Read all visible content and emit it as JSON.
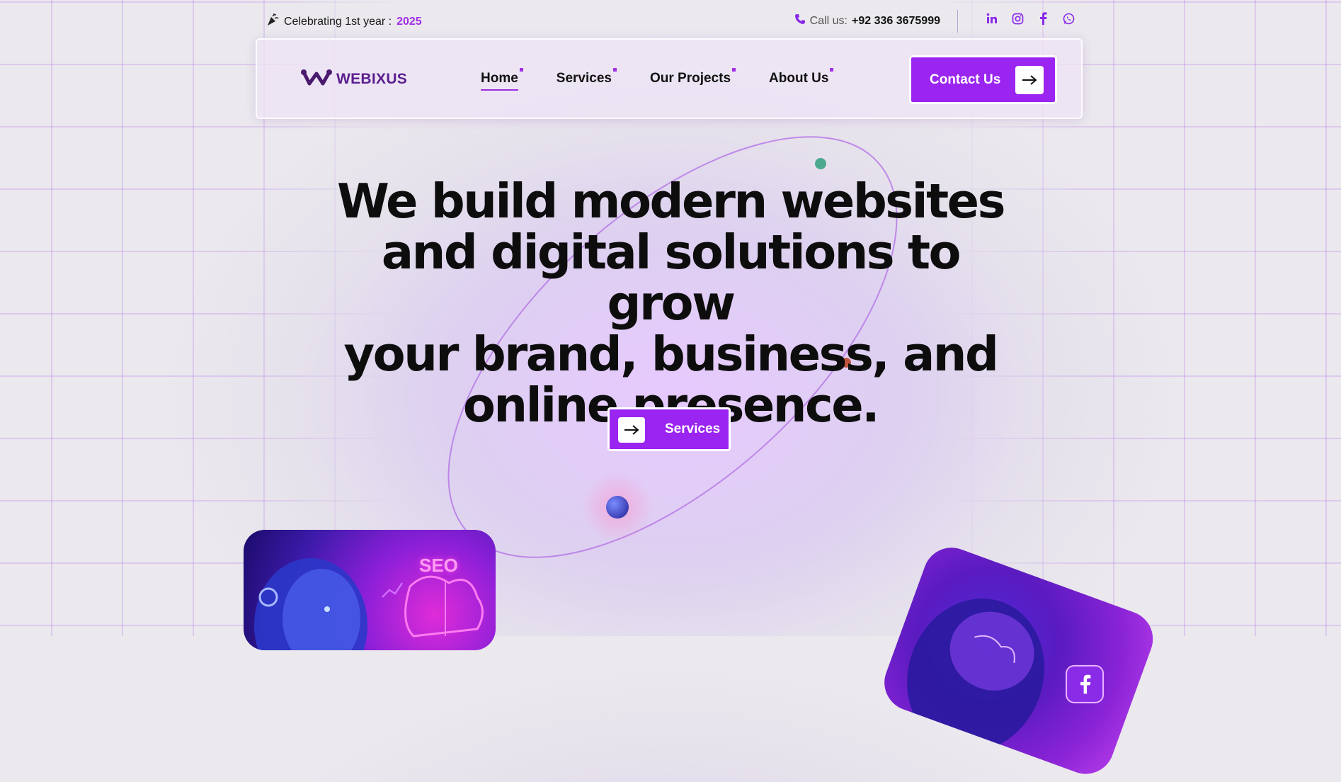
{
  "topbar": {
    "celebrating_text": "Celebrating 1st year :",
    "celebrating_year": "2025",
    "call_label": "Call us:",
    "phone": "+92 336 3675999",
    "socials": [
      "linkedin-icon",
      "instagram-icon",
      "facebook-icon",
      "whatsapp-icon"
    ]
  },
  "nav": {
    "logo_text": "WEBIXUS",
    "items": [
      {
        "label": "Home",
        "active": true
      },
      {
        "label": "Services",
        "active": false
      },
      {
        "label": "Our Projects",
        "active": false
      },
      {
        "label": "About Us",
        "active": false
      }
    ],
    "contact_label": "Contact Us"
  },
  "hero": {
    "title_lines": [
      "We build modern websites",
      "and digital solutions to grow",
      "your brand, business, and",
      "online presence."
    ],
    "cta_label": "Services"
  },
  "cards": {
    "left_badge": "SEO"
  },
  "colors": {
    "accent": "#9b25f0",
    "logo": "#5a1e8e",
    "year": "#a02fe6"
  }
}
